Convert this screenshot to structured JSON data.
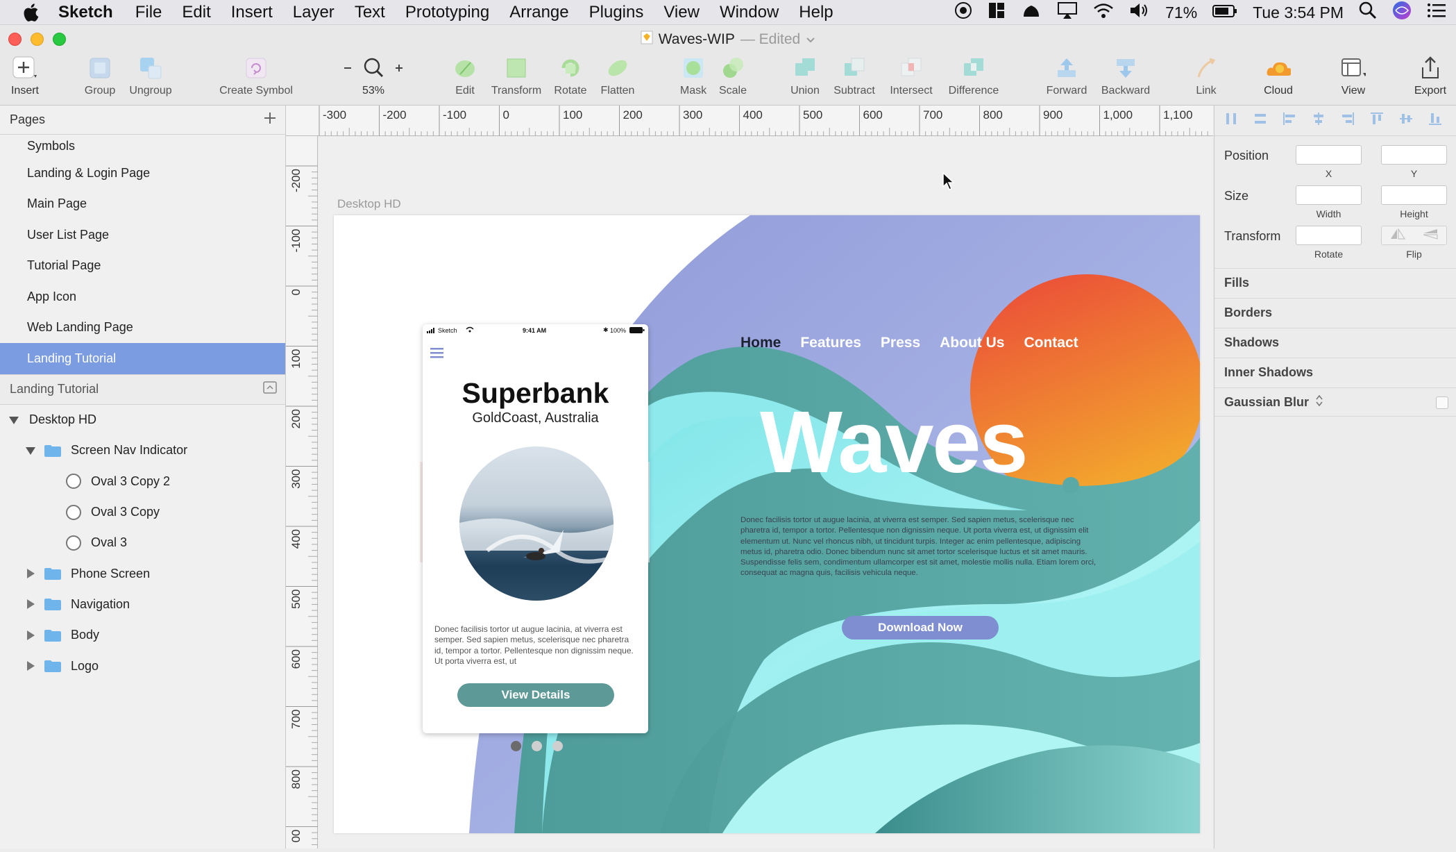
{
  "menubar": {
    "app": "Sketch",
    "items": [
      "File",
      "Edit",
      "Insert",
      "Layer",
      "Text",
      "Prototyping",
      "Arrange",
      "Plugins",
      "View",
      "Window",
      "Help"
    ],
    "battery": "71%",
    "clock": "Tue 3:54 PM"
  },
  "window": {
    "title": "Waves-WIP",
    "status": "— Edited"
  },
  "toolbar": {
    "insert": "Insert",
    "group": "Group",
    "ungroup": "Ungroup",
    "create_symbol": "Create Symbol",
    "zoom": "53%",
    "edit": "Edit",
    "transform": "Transform",
    "rotate": "Rotate",
    "flatten": "Flatten",
    "mask": "Mask",
    "scale": "Scale",
    "union": "Union",
    "subtract": "Subtract",
    "intersect": "Intersect",
    "difference": "Difference",
    "forward": "Forward",
    "backward": "Backward",
    "link": "Link",
    "cloud": "Cloud",
    "view": "View",
    "export": "Export"
  },
  "pages": {
    "header": "Pages",
    "items": [
      "Symbols",
      "Landing & Login Page",
      "Main Page",
      "User List Page",
      "Tutorial Page",
      "App Icon",
      "Web Landing Page",
      "Landing Tutorial"
    ]
  },
  "layers": {
    "header": "Landing Tutorial",
    "items": [
      "Desktop HD",
      "Screen Nav Indicator",
      "Oval 3 Copy 2",
      "Oval 3 Copy",
      "Oval 3",
      "Phone Screen",
      "Navigation",
      "Body",
      "Logo"
    ]
  },
  "ruler": {
    "top": [
      "-300",
      "-200",
      "-100",
      "0",
      "100",
      "200",
      "300",
      "400",
      "500",
      "600",
      "700",
      "800",
      "900",
      "1,000",
      "1,100"
    ],
    "left": [
      "-200",
      "-100",
      "0",
      "100",
      "200",
      "300",
      "400",
      "500",
      "600",
      "700",
      "800",
      "00"
    ]
  },
  "artboard": {
    "label": "Desktop HD",
    "nav": [
      "Home",
      "Features",
      "Press",
      "About Us",
      "Contact"
    ],
    "headline": "Waves",
    "body": "Donec facilisis tortor ut augue lacinia, at viverra est semper. Sed sapien metus, scelerisque nec pharetra id, tempor a tortor. Pellentesque non dignissim neque. Ut porta viverra est, ut dignissim elit elementum ut. Nunc vel rhoncus nibh, ut tincidunt turpis. Integer ac enim pellentesque, adipiscing metus id, pharetra odio. Donec bibendum nunc sit amet tortor scelerisque luctus et sit amet mauris. Suspendisse felis sem, condimentum ullamcorper est sit amet, molestie mollis nulla. Etiam lorem orci, consequat ac magna quis, facilisis vehicula neque.",
    "cta": "Download Now"
  },
  "phone": {
    "carrier": "Sketch",
    "time": "9:41 AM",
    "battery": "100%",
    "title": "Superbank",
    "subtitle": "GoldCoast, Australia",
    "body": "Donec facilisis tortor ut augue lacinia, at viverra est semper. Sed sapien metus, scelerisque nec pharetra id, tempor a tortor. Pellentesque non dignissim neque. Ut porta viverra est, ut",
    "button": "View Details"
  },
  "inspector": {
    "position": "Position",
    "x": "X",
    "y": "Y",
    "size": "Size",
    "width": "Width",
    "height": "Height",
    "transform": "Transform",
    "rotate": "Rotate",
    "flip": "Flip",
    "fills": "Fills",
    "borders": "Borders",
    "shadows": "Shadows",
    "inner_shadows": "Inner Shadows",
    "gaussian_blur": "Gaussian Blur"
  },
  "colors": {
    "selection": "#7b9ce0",
    "folder": "#6fb4ea",
    "wave_teal": "#5aa9a6",
    "wave_cyan": "#9ff0f0",
    "sky": "#9aa7df",
    "sun_top": "#ea5a3a",
    "sun_bottom": "#f2a52e",
    "button": "#5d9a97",
    "cta": "#7f8ed0"
  }
}
